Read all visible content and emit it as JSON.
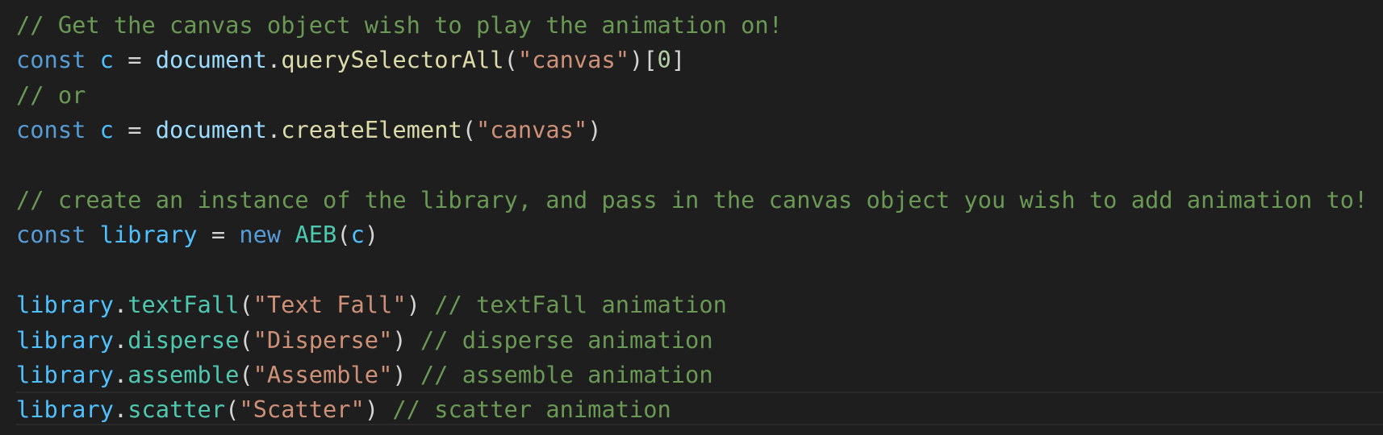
{
  "colors": {
    "background": "#1e1e1e",
    "comment": "#6a9955",
    "keyword": "#569cd6",
    "constant": "#4fc1ff",
    "variable": "#9cdcfe",
    "function": "#dcdcaa",
    "method": "#4ec9b0",
    "class": "#4ec9b0",
    "string": "#ce9178",
    "number": "#b5cea8",
    "text": "#d4d4d4"
  },
  "lines": [
    {
      "tokens": [
        {
          "t": "// Get the canvas object wish to play the animation on!",
          "c": "comment"
        }
      ]
    },
    {
      "tokens": [
        {
          "t": "const",
          "c": "keyword"
        },
        {
          "t": " ",
          "c": "punct"
        },
        {
          "t": "c",
          "c": "constant"
        },
        {
          "t": " = ",
          "c": "punct"
        },
        {
          "t": "document",
          "c": "variable"
        },
        {
          "t": ".",
          "c": "punct"
        },
        {
          "t": "querySelectorAll",
          "c": "func"
        },
        {
          "t": "(",
          "c": "punct"
        },
        {
          "t": "\"canvas\"",
          "c": "string"
        },
        {
          "t": ")[",
          "c": "punct"
        },
        {
          "t": "0",
          "c": "number"
        },
        {
          "t": "]",
          "c": "punct"
        }
      ]
    },
    {
      "tokens": [
        {
          "t": "// or",
          "c": "comment"
        }
      ]
    },
    {
      "tokens": [
        {
          "t": "const",
          "c": "keyword"
        },
        {
          "t": " ",
          "c": "punct"
        },
        {
          "t": "c",
          "c": "constant"
        },
        {
          "t": " = ",
          "c": "punct"
        },
        {
          "t": "document",
          "c": "variable"
        },
        {
          "t": ".",
          "c": "punct"
        },
        {
          "t": "createElement",
          "c": "func"
        },
        {
          "t": "(",
          "c": "punct"
        },
        {
          "t": "\"canvas\"",
          "c": "string"
        },
        {
          "t": ")",
          "c": "punct"
        }
      ]
    },
    {
      "tokens": []
    },
    {
      "tokens": [
        {
          "t": "// create an instance of the library, and pass in the canvas object you wish to add animation to!",
          "c": "comment"
        }
      ]
    },
    {
      "tokens": [
        {
          "t": "const",
          "c": "keyword"
        },
        {
          "t": " ",
          "c": "punct"
        },
        {
          "t": "library",
          "c": "constant"
        },
        {
          "t": " = ",
          "c": "punct"
        },
        {
          "t": "new",
          "c": "keyword"
        },
        {
          "t": " ",
          "c": "punct"
        },
        {
          "t": "AEB",
          "c": "class"
        },
        {
          "t": "(",
          "c": "punct"
        },
        {
          "t": "c",
          "c": "constant"
        },
        {
          "t": ")",
          "c": "punct"
        }
      ]
    },
    {
      "tokens": []
    },
    {
      "tokens": [
        {
          "t": "library",
          "c": "constant"
        },
        {
          "t": ".",
          "c": "punct"
        },
        {
          "t": "textFall",
          "c": "method"
        },
        {
          "t": "(",
          "c": "punct"
        },
        {
          "t": "\"Text Fall\"",
          "c": "string"
        },
        {
          "t": ") ",
          "c": "punct"
        },
        {
          "t": "// textFall animation",
          "c": "comment"
        }
      ]
    },
    {
      "tokens": [
        {
          "t": "library",
          "c": "constant"
        },
        {
          "t": ".",
          "c": "punct"
        },
        {
          "t": "disperse",
          "c": "method"
        },
        {
          "t": "(",
          "c": "punct"
        },
        {
          "t": "\"Disperse\"",
          "c": "string"
        },
        {
          "t": ") ",
          "c": "punct"
        },
        {
          "t": "// disperse animation",
          "c": "comment"
        }
      ]
    },
    {
      "tokens": [
        {
          "t": "library",
          "c": "constant"
        },
        {
          "t": ".",
          "c": "punct"
        },
        {
          "t": "assemble",
          "c": "method"
        },
        {
          "t": "(",
          "c": "punct"
        },
        {
          "t": "\"Assemble\"",
          "c": "string"
        },
        {
          "t": ") ",
          "c": "punct"
        },
        {
          "t": "// assemble animation",
          "c": "comment"
        }
      ]
    },
    {
      "tokens": [
        {
          "t": "library",
          "c": "constant"
        },
        {
          "t": ".",
          "c": "punct"
        },
        {
          "t": "scatter",
          "c": "method"
        },
        {
          "t": "(",
          "c": "punct"
        },
        {
          "t": "\"Scatter\"",
          "c": "string"
        },
        {
          "t": ") ",
          "c": "punct"
        },
        {
          "t": "// scatter animation",
          "c": "comment"
        }
      ]
    }
  ]
}
